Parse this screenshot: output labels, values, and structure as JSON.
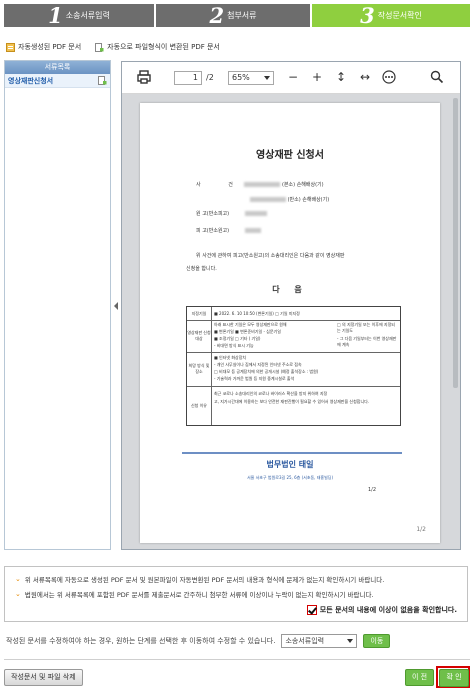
{
  "steps": [
    {
      "num": "1",
      "label": "소송서류입력",
      "active": false
    },
    {
      "num": "2",
      "label": "첨부서류",
      "active": false
    },
    {
      "num": "3",
      "label": "작성문서확인",
      "active": true
    }
  ],
  "doc_tabs": [
    "자동생성된 PDF 문서",
    "자동으로 파일형식이 변환된 PDF 문서"
  ],
  "sidebar": {
    "header": "서류목록",
    "items": [
      "영상재판신청서"
    ]
  },
  "viewer": {
    "page_current": "1",
    "page_total": "/2",
    "zoom": "65%",
    "page": {
      "title": "영상재판 신청서",
      "rows": [
        {
          "label": "사",
          "label2": "건",
          "suffix": "(본소) 손해배상(기)"
        },
        {
          "label": "",
          "label2": "",
          "suffix": "(반소) 손해배상(기)"
        },
        {
          "label": "원",
          "label2": "고(반소피고)",
          "suffix": ""
        },
        {
          "label": "피",
          "label2": "고(반소원고)",
          "suffix": ""
        }
      ],
      "intro_1": "위 사건에 관하여 피고(반소원고)의 소송대리인은 다음과 같이 영상재판",
      "intro_2": "신청을 합니다.",
      "section": "다 음",
      "table": [
        {
          "head": "지정기일",
          "text": "■ 2022. 6. 10 10:50 (변론기일)  □ 기일 미지정"
        },
        {
          "head": "영상재판 신청대상",
          "text": "아래 표시한 기일은 모두 영상재판으로 원해"
        },
        {
          "head": "",
          "text": "■ 변론기일  ■ 변론준비기일 - 심문기일"
        },
        {
          "head": "",
          "text": "■ 조정기일  □ 기타 (          기일)"
        },
        {
          "head": "",
          "text": "- 비대면 방식 표시 기능"
        },
        {
          "head": "희망 방식 및 장소",
          "text": "■ 인터넷 화상장치"
        },
        {
          "head": "",
          "text": "- 개인 사무실이나 집에서 지정된 인터넷 주소로 접속"
        },
        {
          "head": "",
          "text": "□ 비대모 등 공계장치에 의한 공개시설 (예정 출석장소 :     법원)"
        },
        {
          "head": "",
          "text": "- 기술력과 가까운 법원 등 지원 중계시설로 출석"
        },
        {
          "head": "신청 이유",
          "text": "최근 코로나 소송대리인의 코로나 바이러스 확산을 방지 위하여 지정"
        },
        {
          "head": "",
          "text": "고, 지가시간대에 이용하는 보다 안전한 재판진행이 필요할 수 있어서 영상재판을 신청합니다."
        }
      ],
      "side_note_1": "□ 의 지정기일 또는 이후에 지정되는 기일도",
      "side_note_2": "- 그 다음 기일부터는 이번 영상재판에 계속",
      "firm_name": "법무법인 태일",
      "firm_addr": "서울 서초구 법원로3길 25, 6층 (서초동, 태흥빌딩)",
      "page_fraction": "1/2",
      "page_indicator": "1/2"
    }
  },
  "notice": {
    "line1": "위 서류목록에 자동으로 생성된 PDF 문서 및 원본파일이 자동변환된 PDF 문서의 내용과 형식에 문제가 없는지 확인하시기 바랍니다.",
    "line2": "법원에서는 위 서류목록에 포함된 PDF 문서를 제출문서로 간주하니 첨부한 서류에 이상이나 누락이 없는지 확인하시기 바랍니다.",
    "confirm": "모든 문서의 내용에 이상이 없음을 확인합니다."
  },
  "edit": {
    "text": "작성된 문서를 수정하여야 하는 경우, 원하는 단계를 선택한 후 이동하여 수정할 수 있습니다.",
    "select_value": "소송서류입력",
    "move_btn": "이동"
  },
  "buttons": {
    "delete": "작성문서 및 파일 삭제",
    "prev": "이 전",
    "ok": "확 인"
  },
  "colors": {
    "active_step": "#8fcf3f",
    "inactive_step": "#6d6d6d",
    "button_green": "#6fbf4a",
    "highlight_red": "#d40000",
    "link_blue": "#1d5aa8"
  }
}
